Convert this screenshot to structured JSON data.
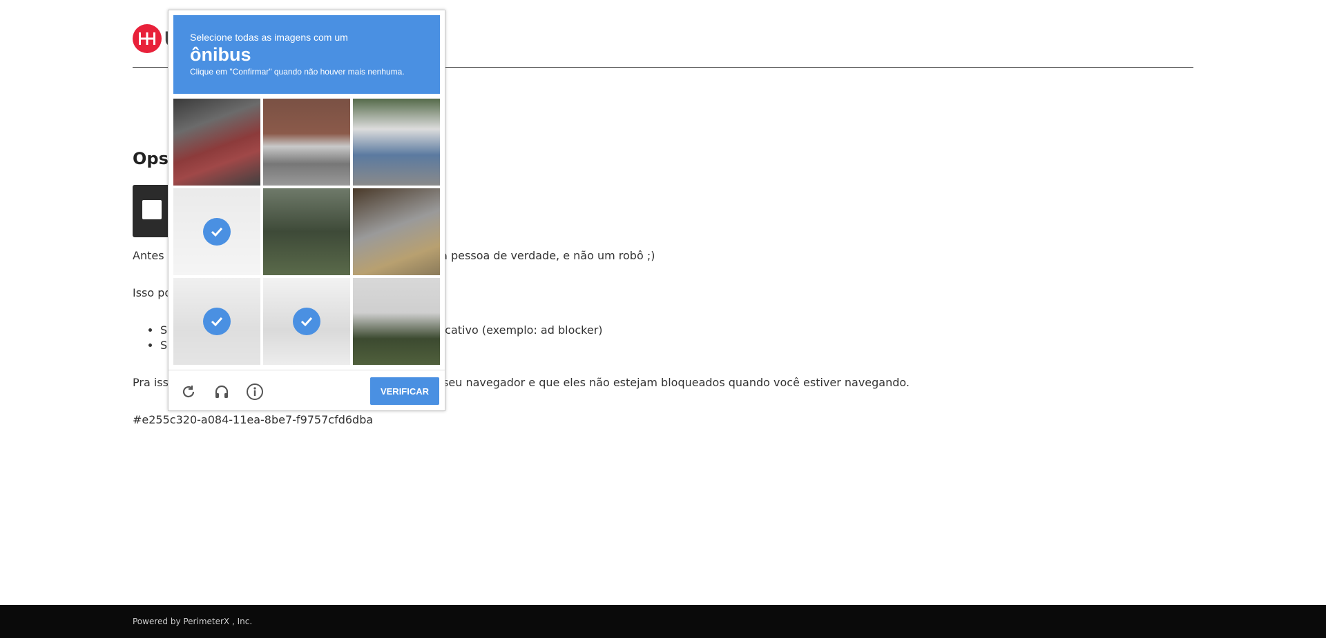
{
  "page": {
    "logo_letter": "U",
    "heading": "Ops! Você é um robô?",
    "p1": "Antes de continuar, precisamos garantir que você é uma pessoa de verdade, e não um robô ;)",
    "p2": "Isso pode acontecer quando:",
    "list": [
      "Seu navegador está utilizando algum plugin ou aplicativo (exemplo: ad blocker)",
      "Seu navegador não suporta cookies"
    ],
    "p3": "Pra isso, é necessário que os cookies estejam ativos no seu navegador e que eles não estejam bloqueados quando você estiver navegando.",
    "ref": "#e255c320-a084-11ea-8be7-f9757cfd6dba"
  },
  "captcha": {
    "line1": "Selecione todas as imagens com um",
    "word": "ônibus",
    "line2": "Clique em \"Confirmar\" quando não houver mais nenhuma.",
    "tiles": [
      {
        "selected": false
      },
      {
        "selected": false
      },
      {
        "selected": false
      },
      {
        "selected": true
      },
      {
        "selected": false
      },
      {
        "selected": false
      },
      {
        "selected": true
      },
      {
        "selected": true
      },
      {
        "selected": false
      }
    ],
    "verify_label": "VERIFICAR",
    "icons": [
      "reload-icon",
      "audio-icon",
      "info-icon"
    ],
    "accent_color": "#4a90e2"
  },
  "footer": {
    "text": "Powered by PerimeterX , Inc."
  }
}
